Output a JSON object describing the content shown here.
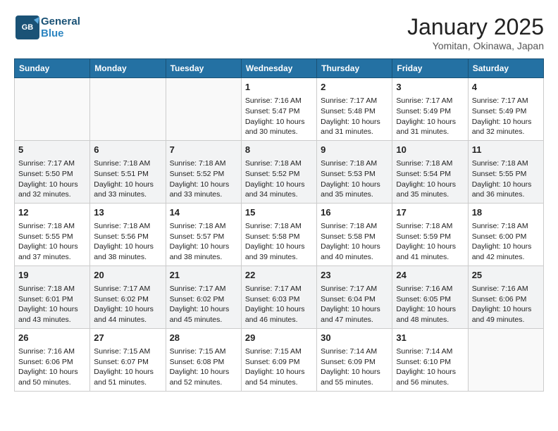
{
  "header": {
    "logo_line1": "General",
    "logo_line2": "Blue",
    "month": "January 2025",
    "location": "Yomitan, Okinawa, Japan"
  },
  "weekdays": [
    "Sunday",
    "Monday",
    "Tuesday",
    "Wednesday",
    "Thursday",
    "Friday",
    "Saturday"
  ],
  "weeks": [
    [
      {
        "day": "",
        "info": ""
      },
      {
        "day": "",
        "info": ""
      },
      {
        "day": "",
        "info": ""
      },
      {
        "day": "1",
        "info": "Sunrise: 7:16 AM\nSunset: 5:47 PM\nDaylight: 10 hours\nand 30 minutes."
      },
      {
        "day": "2",
        "info": "Sunrise: 7:17 AM\nSunset: 5:48 PM\nDaylight: 10 hours\nand 31 minutes."
      },
      {
        "day": "3",
        "info": "Sunrise: 7:17 AM\nSunset: 5:49 PM\nDaylight: 10 hours\nand 31 minutes."
      },
      {
        "day": "4",
        "info": "Sunrise: 7:17 AM\nSunset: 5:49 PM\nDaylight: 10 hours\nand 32 minutes."
      }
    ],
    [
      {
        "day": "5",
        "info": "Sunrise: 7:17 AM\nSunset: 5:50 PM\nDaylight: 10 hours\nand 32 minutes."
      },
      {
        "day": "6",
        "info": "Sunrise: 7:18 AM\nSunset: 5:51 PM\nDaylight: 10 hours\nand 33 minutes."
      },
      {
        "day": "7",
        "info": "Sunrise: 7:18 AM\nSunset: 5:52 PM\nDaylight: 10 hours\nand 33 minutes."
      },
      {
        "day": "8",
        "info": "Sunrise: 7:18 AM\nSunset: 5:52 PM\nDaylight: 10 hours\nand 34 minutes."
      },
      {
        "day": "9",
        "info": "Sunrise: 7:18 AM\nSunset: 5:53 PM\nDaylight: 10 hours\nand 35 minutes."
      },
      {
        "day": "10",
        "info": "Sunrise: 7:18 AM\nSunset: 5:54 PM\nDaylight: 10 hours\nand 35 minutes."
      },
      {
        "day": "11",
        "info": "Sunrise: 7:18 AM\nSunset: 5:55 PM\nDaylight: 10 hours\nand 36 minutes."
      }
    ],
    [
      {
        "day": "12",
        "info": "Sunrise: 7:18 AM\nSunset: 5:55 PM\nDaylight: 10 hours\nand 37 minutes."
      },
      {
        "day": "13",
        "info": "Sunrise: 7:18 AM\nSunset: 5:56 PM\nDaylight: 10 hours\nand 38 minutes."
      },
      {
        "day": "14",
        "info": "Sunrise: 7:18 AM\nSunset: 5:57 PM\nDaylight: 10 hours\nand 38 minutes."
      },
      {
        "day": "15",
        "info": "Sunrise: 7:18 AM\nSunset: 5:58 PM\nDaylight: 10 hours\nand 39 minutes."
      },
      {
        "day": "16",
        "info": "Sunrise: 7:18 AM\nSunset: 5:58 PM\nDaylight: 10 hours\nand 40 minutes."
      },
      {
        "day": "17",
        "info": "Sunrise: 7:18 AM\nSunset: 5:59 PM\nDaylight: 10 hours\nand 41 minutes."
      },
      {
        "day": "18",
        "info": "Sunrise: 7:18 AM\nSunset: 6:00 PM\nDaylight: 10 hours\nand 42 minutes."
      }
    ],
    [
      {
        "day": "19",
        "info": "Sunrise: 7:18 AM\nSunset: 6:01 PM\nDaylight: 10 hours\nand 43 minutes."
      },
      {
        "day": "20",
        "info": "Sunrise: 7:17 AM\nSunset: 6:02 PM\nDaylight: 10 hours\nand 44 minutes."
      },
      {
        "day": "21",
        "info": "Sunrise: 7:17 AM\nSunset: 6:02 PM\nDaylight: 10 hours\nand 45 minutes."
      },
      {
        "day": "22",
        "info": "Sunrise: 7:17 AM\nSunset: 6:03 PM\nDaylight: 10 hours\nand 46 minutes."
      },
      {
        "day": "23",
        "info": "Sunrise: 7:17 AM\nSunset: 6:04 PM\nDaylight: 10 hours\nand 47 minutes."
      },
      {
        "day": "24",
        "info": "Sunrise: 7:16 AM\nSunset: 6:05 PM\nDaylight: 10 hours\nand 48 minutes."
      },
      {
        "day": "25",
        "info": "Sunrise: 7:16 AM\nSunset: 6:06 PM\nDaylight: 10 hours\nand 49 minutes."
      }
    ],
    [
      {
        "day": "26",
        "info": "Sunrise: 7:16 AM\nSunset: 6:06 PM\nDaylight: 10 hours\nand 50 minutes."
      },
      {
        "day": "27",
        "info": "Sunrise: 7:15 AM\nSunset: 6:07 PM\nDaylight: 10 hours\nand 51 minutes."
      },
      {
        "day": "28",
        "info": "Sunrise: 7:15 AM\nSunset: 6:08 PM\nDaylight: 10 hours\nand 52 minutes."
      },
      {
        "day": "29",
        "info": "Sunrise: 7:15 AM\nSunset: 6:09 PM\nDaylight: 10 hours\nand 54 minutes."
      },
      {
        "day": "30",
        "info": "Sunrise: 7:14 AM\nSunset: 6:09 PM\nDaylight: 10 hours\nand 55 minutes."
      },
      {
        "day": "31",
        "info": "Sunrise: 7:14 AM\nSunset: 6:10 PM\nDaylight: 10 hours\nand 56 minutes."
      },
      {
        "day": "",
        "info": ""
      }
    ]
  ]
}
